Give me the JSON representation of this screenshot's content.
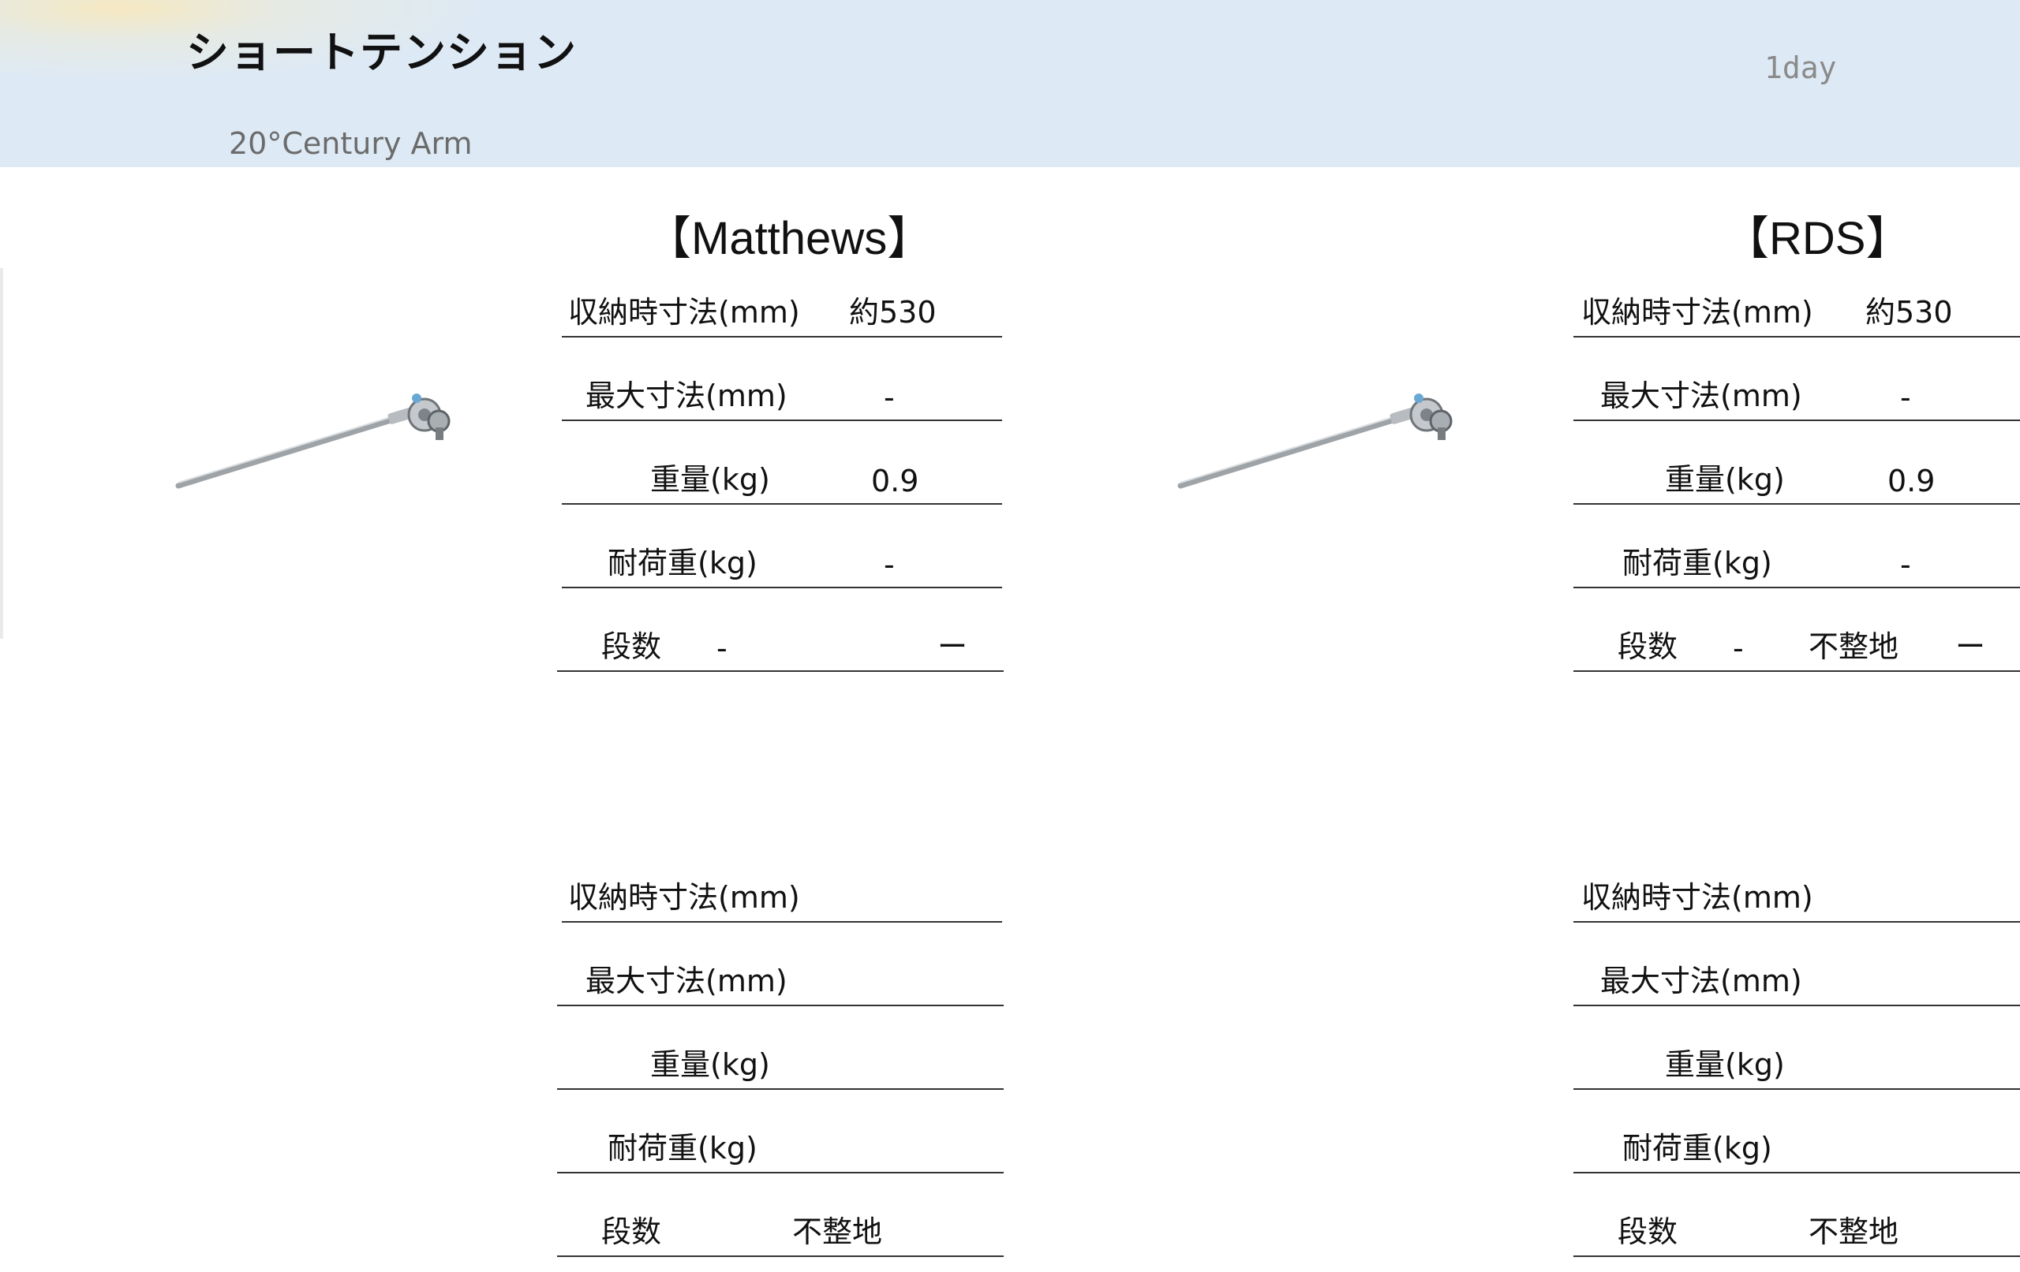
{
  "header": {
    "title": "ショートテンション",
    "subtitle": "20°Century Arm",
    "rental_unit": "1day"
  },
  "products": [
    {
      "brand": "【Matthews】",
      "image_icon": "century-arm-image",
      "specs": [
        {
          "label": "収納時寸法(mm)",
          "value": "約530"
        },
        {
          "label": "最大寸法(mm)",
          "value": "-"
        },
        {
          "label": "重量(kg)",
          "value": "0.9"
        },
        {
          "label": "耐荷重(kg)",
          "value": "-"
        },
        {
          "label": "段数",
          "value": "-",
          "terrain": "",
          "terrain_value": "ー"
        }
      ]
    },
    {
      "brand": "【RDS】",
      "image_icon": "century-arm-image",
      "specs": [
        {
          "label": "収納時寸法(mm)",
          "value": "約530"
        },
        {
          "label": "最大寸法(mm)",
          "value": "-"
        },
        {
          "label": "重量(kg)",
          "value": "0.9"
        },
        {
          "label": "耐荷重(kg)",
          "value": "-"
        },
        {
          "label": "段数",
          "value": "-",
          "terrain": "不整地",
          "terrain_value": "ー"
        }
      ]
    },
    {
      "brand": "",
      "specs": [
        {
          "label": "収納時寸法(mm)",
          "value": ""
        },
        {
          "label": "最大寸法(mm)",
          "value": ""
        },
        {
          "label": "重量(kg)",
          "value": ""
        },
        {
          "label": "耐荷重(kg)",
          "value": ""
        },
        {
          "label": "段数",
          "value": "",
          "terrain": "不整地",
          "terrain_value": ""
        }
      ]
    },
    {
      "brand": "",
      "specs": [
        {
          "label": "収納時寸法(mm)",
          "value": ""
        },
        {
          "label": "最大寸法(mm)",
          "value": ""
        },
        {
          "label": "重量(kg)",
          "value": ""
        },
        {
          "label": "耐荷重(kg)",
          "value": ""
        },
        {
          "label": "段数",
          "value": "",
          "terrain": "不整地",
          "terrain_value": ""
        }
      ]
    }
  ]
}
